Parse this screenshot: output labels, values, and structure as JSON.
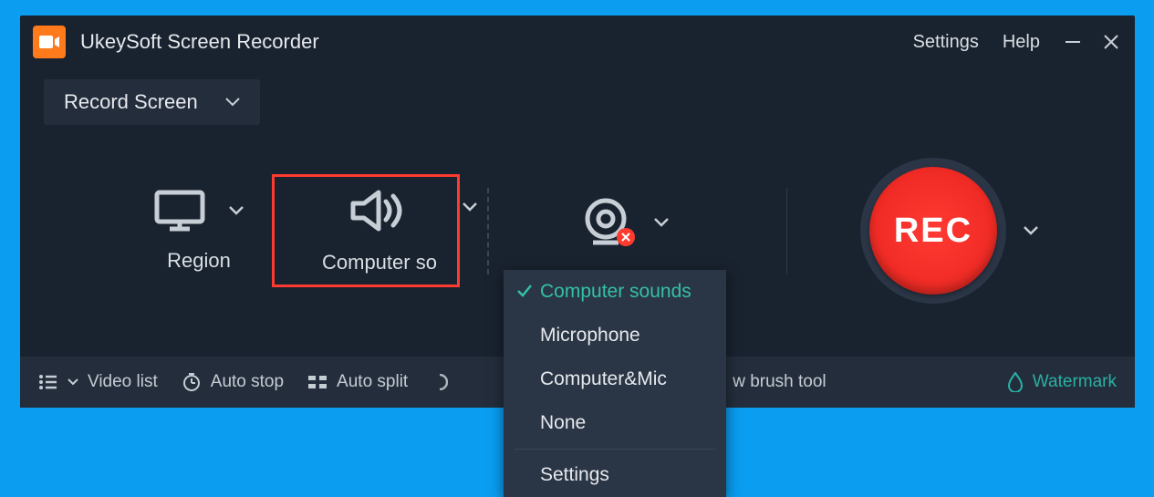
{
  "app": {
    "title": "UkeySoft Screen Recorder"
  },
  "titlebar": {
    "settings": "Settings",
    "help": "Help"
  },
  "mode": {
    "label": "Record Screen"
  },
  "panels": {
    "region": {
      "label": "Region"
    },
    "audio": {
      "label": "Computer sounds"
    },
    "webcam": {
      "label": ""
    }
  },
  "rec": {
    "label": "REC"
  },
  "audio_menu": {
    "items": [
      {
        "label": "Computer sounds",
        "selected": true
      },
      {
        "label": "Microphone",
        "selected": false
      },
      {
        "label": "Computer&Mic",
        "selected": false
      },
      {
        "label": "None",
        "selected": false
      }
    ],
    "settings": "Settings"
  },
  "bottombar": {
    "video_list": "Video list",
    "auto_stop": "Auto stop",
    "auto_split": "Auto split",
    "brush": "w brush tool",
    "watermark": "Watermark"
  }
}
